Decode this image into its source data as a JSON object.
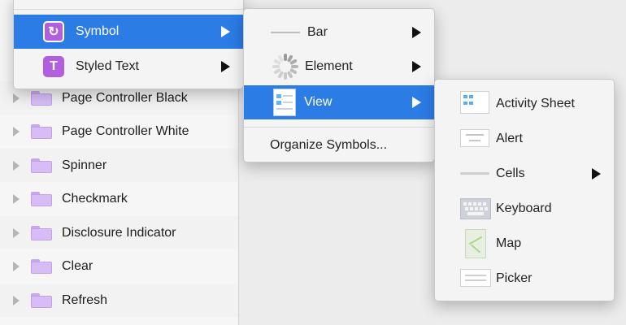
{
  "layers": [
    {
      "label": "Page Controller Black"
    },
    {
      "label": "Page Controller White"
    },
    {
      "label": "Spinner"
    },
    {
      "label": "Checkmark"
    },
    {
      "label": "Disclosure Indicator"
    },
    {
      "label": "Clear"
    },
    {
      "label": "Refresh"
    }
  ],
  "menu1": {
    "items": [
      {
        "label": "Symbol",
        "icon": "symbol-refresh-icon",
        "glyph": "↻"
      },
      {
        "label": "Styled Text",
        "icon": "styled-text-icon",
        "glyph": "T"
      }
    ]
  },
  "menu2": {
    "items": [
      {
        "label": "Bar"
      },
      {
        "label": "Element"
      },
      {
        "label": "View"
      }
    ],
    "organize": "Organize Symbols..."
  },
  "menu3": {
    "items": [
      {
        "label": "Activity Sheet"
      },
      {
        "label": "Alert"
      },
      {
        "label": "Cells"
      },
      {
        "label": "Keyboard"
      },
      {
        "label": "Map"
      },
      {
        "label": "Picker"
      }
    ]
  },
  "colors": {
    "selection": "#2c7ce6",
    "folder": "#d7bcf6",
    "symbol_icon": "#b25ee0"
  }
}
